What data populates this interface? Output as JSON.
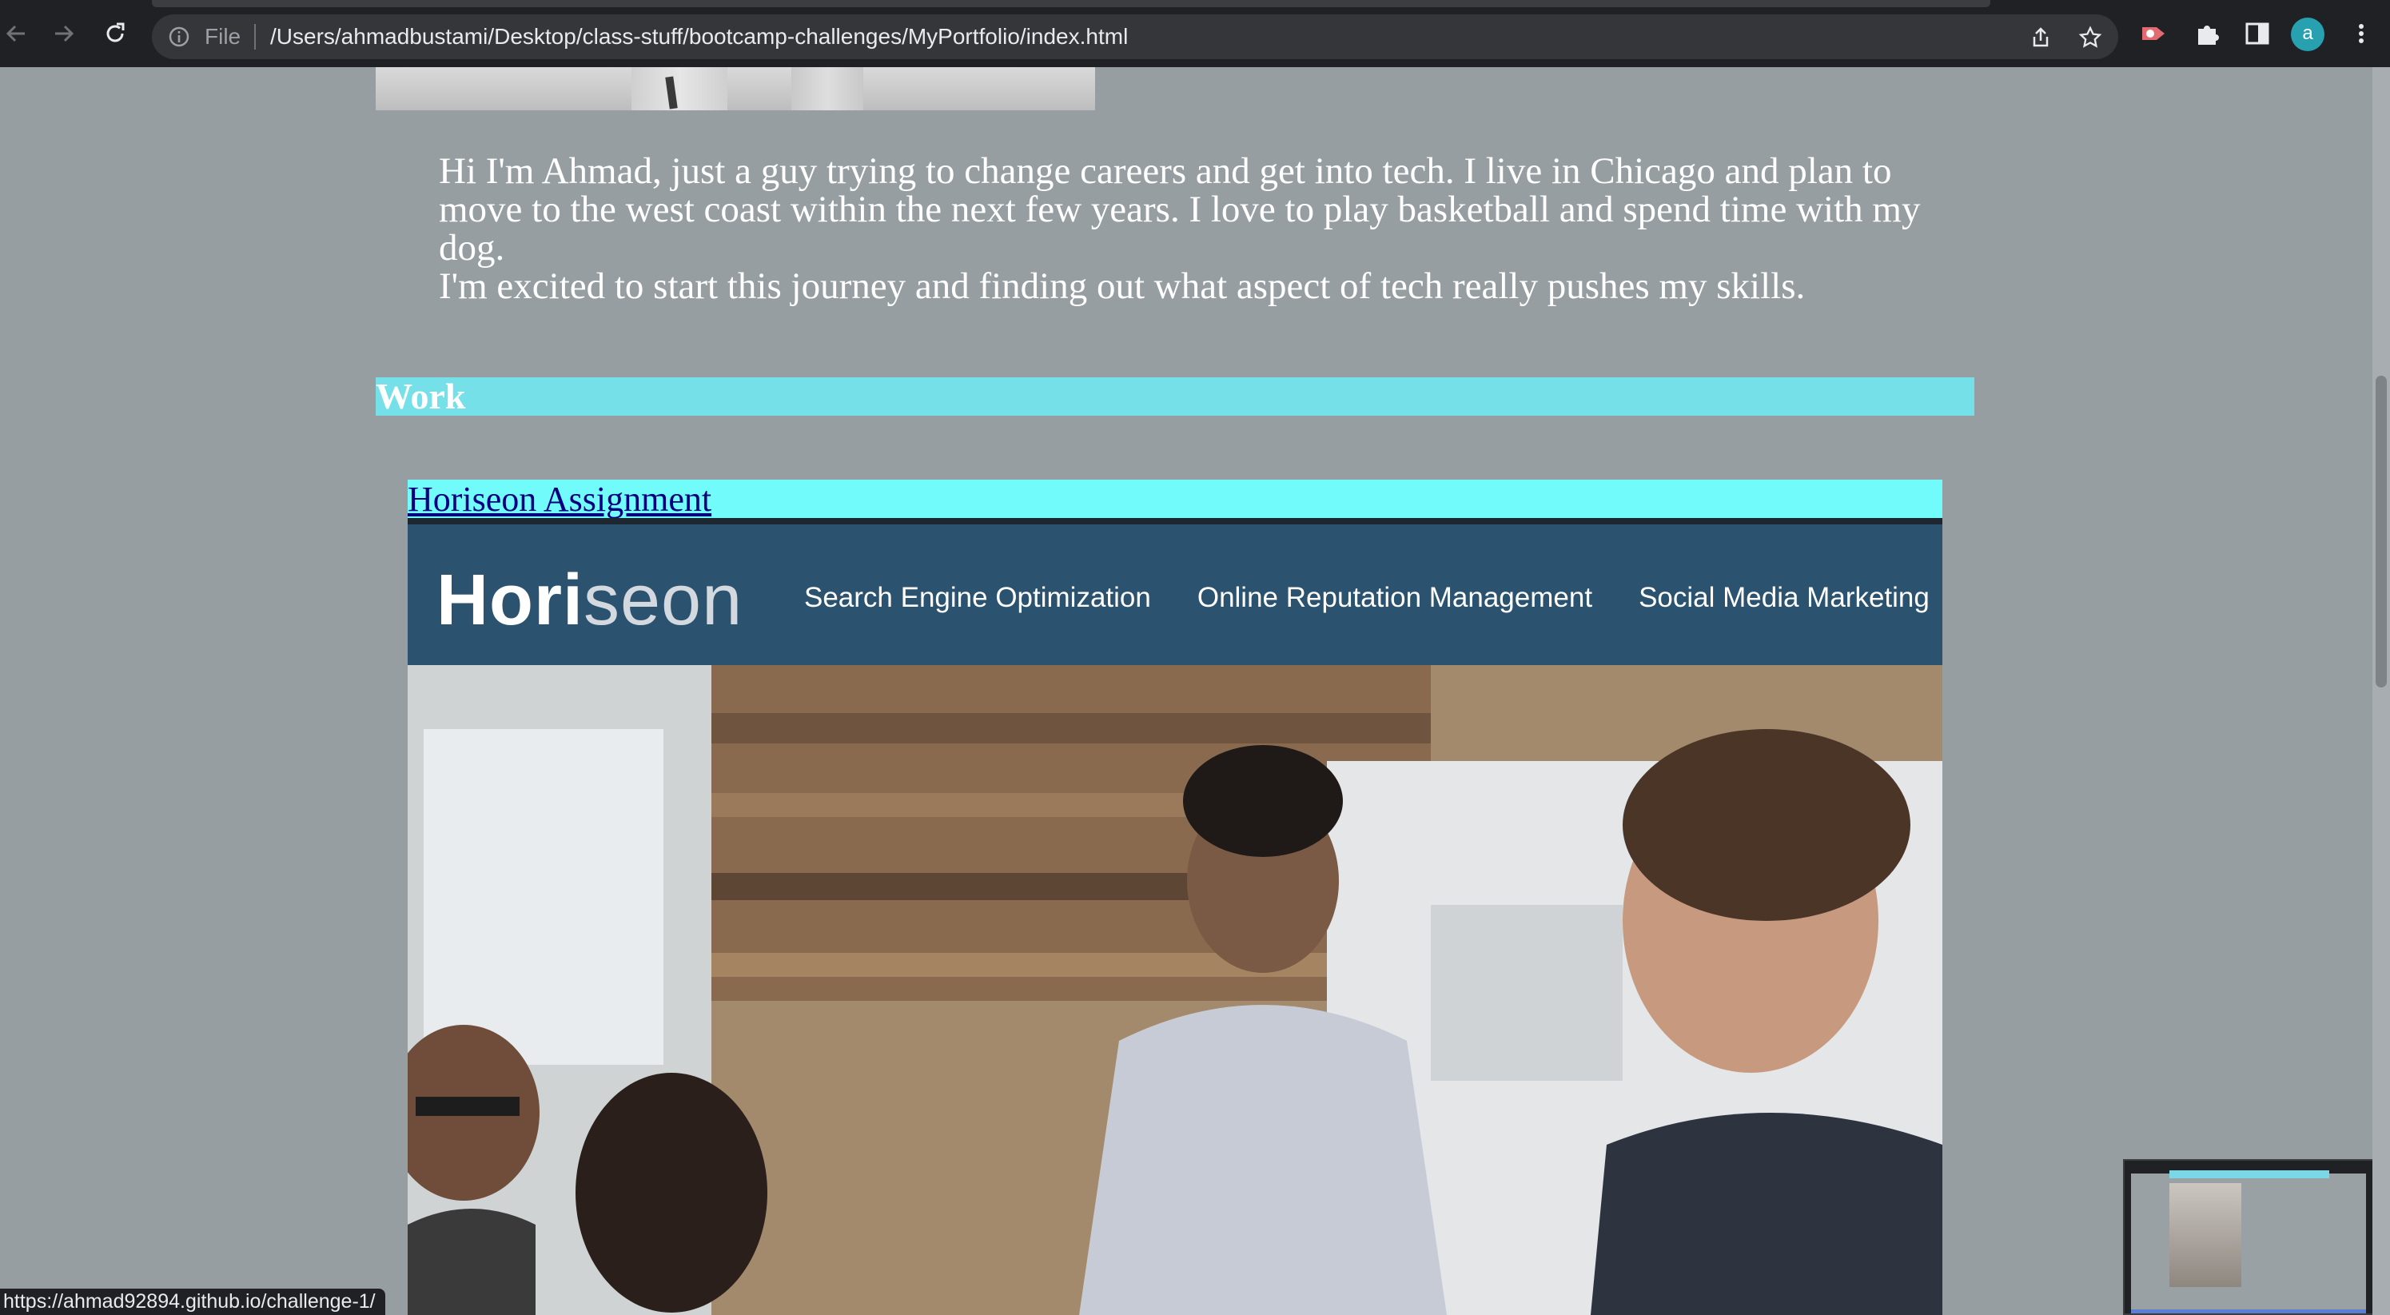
{
  "browser": {
    "omnibox": {
      "scheme_label": "File",
      "url": "/Users/ahmadbustami/Desktop/class-stuff/bootcamp-challenges/MyPortfolio/index.html"
    },
    "profile_initial": "a"
  },
  "page": {
    "about": {
      "paragraph_1": "Hi I'm Ahmad, just a guy trying to change careers and get into tech. I live in Chicago and plan to move to the west coast within the next few years. I love to play basketball and spend time with my dog.",
      "paragraph_2": "I'm excited to start this journey and finding out what aspect of tech really pushes my skills."
    },
    "work": {
      "heading": "Work",
      "projects": [
        {
          "title": "Horiseon Assignment",
          "preview": {
            "logo_main": "Hori",
            "logo_accent": "seon",
            "nav_links": [
              "Search Engine Optimization",
              "Online Reputation Management",
              "Social Media Marketing"
            ]
          }
        }
      ]
    }
  },
  "status_bar": {
    "link_url": "https://ahmad92894.github.io/challenge-1/"
  },
  "colors": {
    "page_background": "#979ea2",
    "work_header_bg": "#76e0e9",
    "project_title_bg": "#71fbfa",
    "horiseon_nav_bg": "#2b526f"
  }
}
